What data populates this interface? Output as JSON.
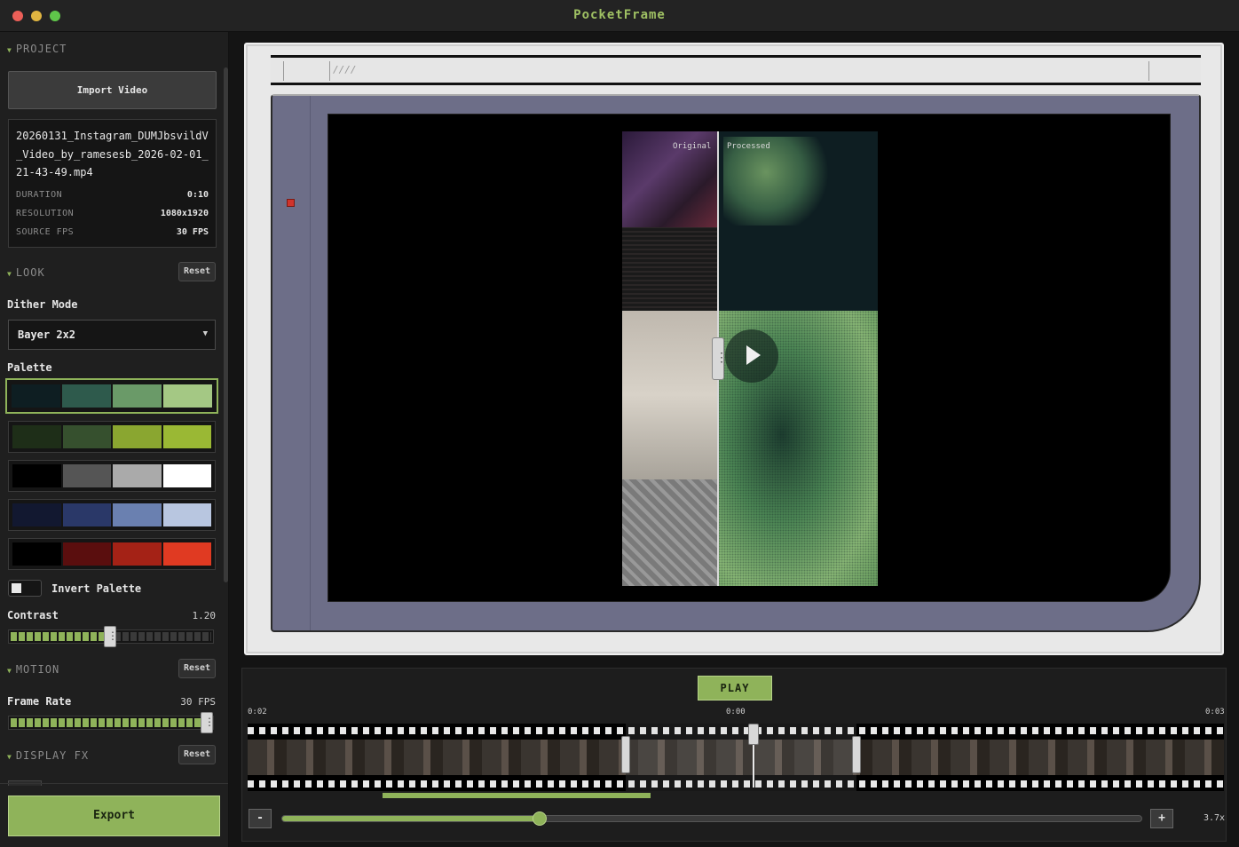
{
  "window": {
    "title": "PocketFrame"
  },
  "project": {
    "heading": "PROJECT",
    "import_label": "Import Video",
    "filename": "20260131_Instagram_DUMJbsvildV_Video_by_ramesesb_2026-02-01_21-43-49.mp4",
    "meta": [
      {
        "key": "DURATION",
        "value": "0:10"
      },
      {
        "key": "RESOLUTION",
        "value": "1080x1920"
      },
      {
        "key": "SOURCE FPS",
        "value": "30 FPS"
      }
    ]
  },
  "look": {
    "heading": "LOOK",
    "reset_label": "Reset",
    "dither_label": "Dither Mode",
    "dither_value": "Bayer 2x2",
    "palette_label": "Palette",
    "palettes": [
      {
        "colors": [
          "#0e1e22",
          "#2e5a4c",
          "#6a9a68",
          "#a4c884"
        ],
        "selected": true
      },
      {
        "colors": [
          "#1e2e18",
          "#36502e",
          "#8aa630",
          "#9ab834"
        ],
        "selected": false
      },
      {
        "colors": [
          "#000000",
          "#555555",
          "#aaaaaa",
          "#ffffff"
        ],
        "selected": false
      },
      {
        "colors": [
          "#121830",
          "#2a3868",
          "#6a80b0",
          "#b8c6e0"
        ],
        "selected": false
      },
      {
        "colors": [
          "#000000",
          "#5a0e0e",
          "#a42216",
          "#e03a22"
        ],
        "selected": false
      }
    ],
    "invert_label": "Invert Palette",
    "invert_checked": true,
    "contrast_label": "Contrast",
    "contrast_value": "1.20",
    "contrast_fraction": 0.47
  },
  "motion": {
    "heading": "MOTION",
    "reset_label": "Reset",
    "frame_rate_label": "Frame Rate",
    "frame_rate_value": "30 FPS",
    "frame_rate_fraction": 1.0
  },
  "display_fx": {
    "heading": "DISPLAY FX",
    "reset_label": "Reset"
  },
  "export_label": "Export",
  "preview": {
    "original_label": "Original",
    "processed_label": "Processed",
    "split_fraction": 0.375
  },
  "timeline": {
    "play_label": "PLAY",
    "time_start": "0:02",
    "time_current": "0:00",
    "time_end": "0:03",
    "zoom_minus": "-",
    "zoom_plus": "+",
    "zoom_value": "3.7x",
    "zoom_fraction": 0.3
  },
  "colors": {
    "accent": "#8fb35a",
    "led": "#d0342c"
  }
}
